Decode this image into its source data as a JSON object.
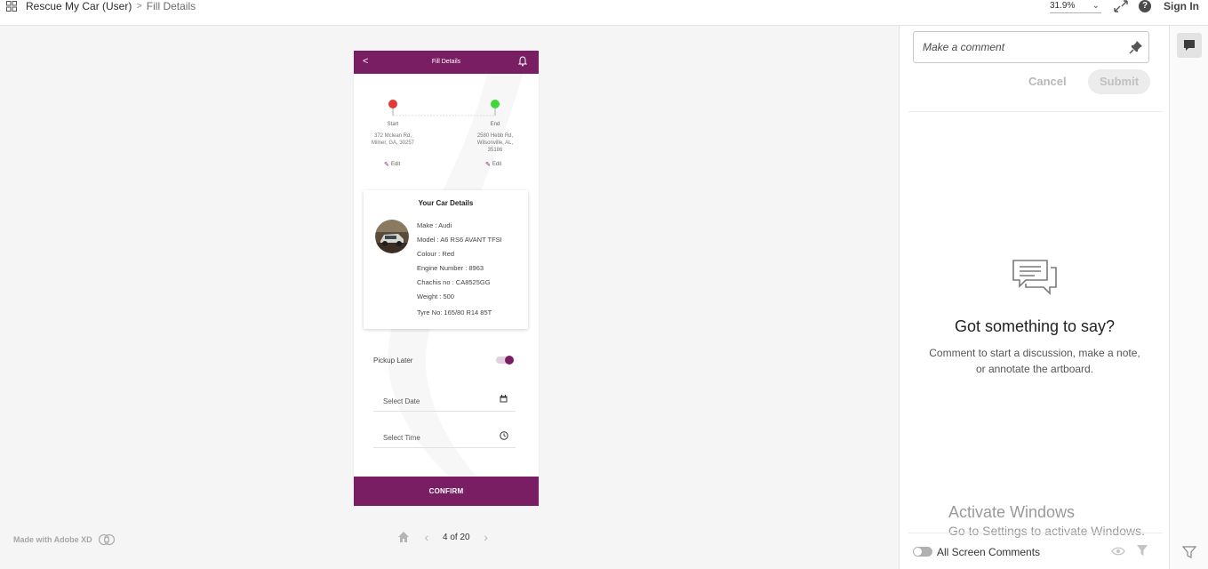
{
  "topbar": {
    "project": "Rescue My Car (User)",
    "separator": ">",
    "page": "Fill Details",
    "zoom": "31.9%",
    "sign_in": "Sign In",
    "help_glyph": "?"
  },
  "canvas": {
    "made_with": "Made with Adobe XD",
    "pager": "4 of 20"
  },
  "phone": {
    "header_title": "Fill Details",
    "back_glyph": "<",
    "start": {
      "label": "Start",
      "address_line1": "372 Mclean Rd,",
      "address_line2": "Milner, GA, 30257",
      "edit": "Edit",
      "color": "#e53935"
    },
    "end": {
      "label": "End",
      "address_line1": "2580 Hebb Rd,",
      "address_line2": "Wilsonville, AL,",
      "address_line3": "35186",
      "edit": "Edit",
      "color": "#43d63b"
    },
    "car_card": {
      "heading": "Your Car Details",
      "specs": [
        "Make : Audi",
        "Model : A6 RS6 AVANT TFSI",
        "Colour : Red",
        "Engine Number : 8963",
        "Chachis no : CA8525GG",
        "Weight : 500",
        "Tyre No: 165/80 R14 85T"
      ]
    },
    "pickup_later": {
      "label": "Pickup Later",
      "on": true
    },
    "select_date": {
      "label": "Select Date",
      "icon": "calendar-icon"
    },
    "select_time": {
      "label": "Select Time",
      "icon": "clock-icon"
    },
    "confirm": "CONFIRM",
    "accent": "#7a1e63"
  },
  "comments": {
    "placeholder": "Make a comment",
    "cancel": "Cancel",
    "submit": "Submit",
    "empty_title": "Got something to say?",
    "empty_text": "Comment to start a discussion, make a note, or annotate the artboard.",
    "activate_title": "Activate Windows",
    "activate_text": "Go to Settings to activate Windows.",
    "all_screen_comments": "All Screen Comments"
  }
}
